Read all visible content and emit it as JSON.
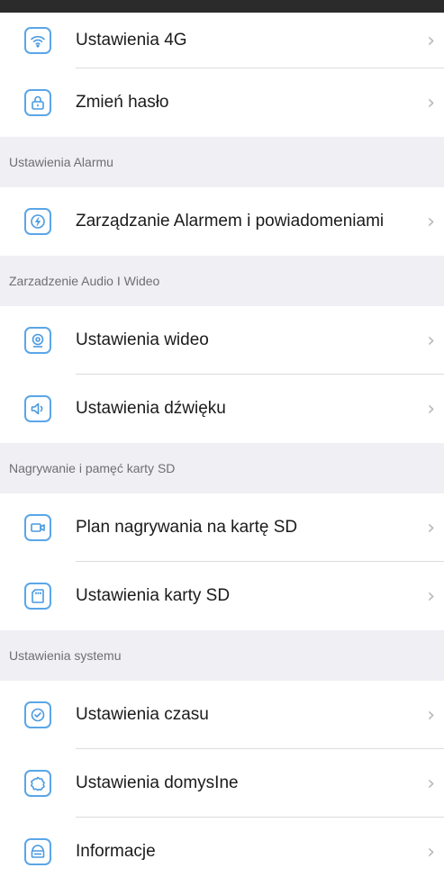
{
  "colors": {
    "accent": "#4a9ae0",
    "background": "#efeff4",
    "topbar": "#2b2b2b"
  },
  "groups": {
    "network": {
      "items": [
        {
          "label": "Ustawienia 4G",
          "icon": "wifi-icon"
        },
        {
          "label": "Zmień hasło",
          "icon": "lock-icon"
        }
      ]
    },
    "alarm": {
      "header": "Ustawienia Alarmu",
      "items": [
        {
          "label": "Zarządzanie Alarmem i powiadomeniami",
          "icon": "alarm-icon"
        }
      ]
    },
    "audio_video": {
      "header": "Zarzadzenie Audio I Wideo",
      "items": [
        {
          "label": "Ustawienia wideo",
          "icon": "camera-icon"
        },
        {
          "label": "Ustawienia dźwięku",
          "icon": "speaker-icon"
        }
      ]
    },
    "recording": {
      "header": "Nagrywanie i pamęć karty SD",
      "items": [
        {
          "label": "Plan nagrywania na kartę SD",
          "icon": "video-recorder-icon"
        },
        {
          "label": "Ustawienia karty SD",
          "icon": "sd-card-icon"
        }
      ]
    },
    "system": {
      "header": "Ustawienia systemu",
      "items": [
        {
          "label": "Ustawienia czasu",
          "icon": "clock-check-icon"
        },
        {
          "label": "Ustawienia domysIne",
          "icon": "reset-icon"
        },
        {
          "label": "Informacje",
          "icon": "info-device-icon"
        }
      ]
    }
  },
  "chevron": "›"
}
